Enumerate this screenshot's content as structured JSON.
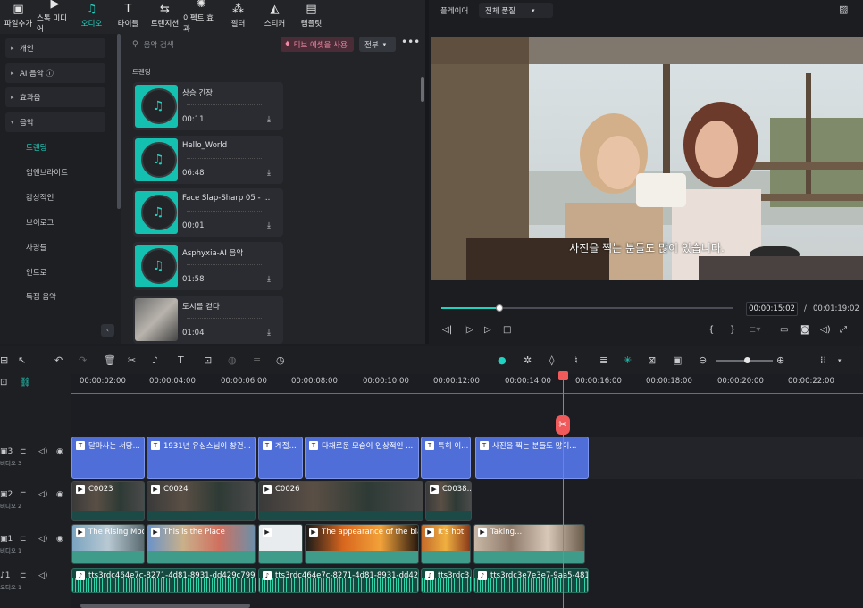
{
  "toolbar": [
    {
      "label": "파일추가",
      "icon": "import-icon"
    },
    {
      "label": "스톡 미디어",
      "icon": "stock-icon"
    },
    {
      "label": "오디오",
      "icon": "music-icon",
      "active": true
    },
    {
      "label": "타이틀",
      "icon": "title-icon"
    },
    {
      "label": "트랜지션",
      "icon": "transition-icon"
    },
    {
      "label": "이펙트 효과",
      "icon": "effects-icon"
    },
    {
      "label": "필터",
      "icon": "filter-icon"
    },
    {
      "label": "스티커",
      "icon": "sticker-icon"
    },
    {
      "label": "템플릿",
      "icon": "template-icon"
    }
  ],
  "sidebar": {
    "groups": [
      "개인",
      "AI 음악 ⓘ",
      "효과음",
      "음악"
    ],
    "subitems": [
      "트랜딩",
      "엄앤브라이트",
      "감상적인",
      "브이로그",
      "사랑들",
      "인트로",
      "독점 음악"
    ],
    "selected": "트랜딩"
  },
  "library": {
    "search_placeholder": "음악 검색",
    "promo": "티브 에셋을 사용",
    "filter": "전부",
    "section": "트랜딩",
    "tracks": [
      {
        "name": "상승 긴장",
        "duration": "00:11"
      },
      {
        "name": "Hello_World",
        "duration": "06:48"
      },
      {
        "name": "Face Slap-Sharp 05 - ...",
        "duration": "00:01"
      },
      {
        "name": "Asphyxia-AI 음악",
        "duration": "01:58"
      },
      {
        "name": "도시를 걷다",
        "duration": "01:04"
      }
    ]
  },
  "player": {
    "title": "플레이어",
    "quality": "전체 품질",
    "caption": "사진을 찍는 분들도 많이 있습니다.",
    "current_time": "00:00:15:02",
    "separator": "/",
    "total_time": "00:01:19:02",
    "progress": 0.2
  },
  "timeline": {
    "ticks": [
      "00:00:02:00",
      "00:00:04:00",
      "00:00:06:00",
      "00:00:08:00",
      "00:00:10:00",
      "00:00:12:00",
      "00:00:14:00",
      "00:00:16:00",
      "00:00:18:00",
      "00:00:20:00",
      "00:00:22:00"
    ],
    "tracks": [
      {
        "num": "3",
        "label": "비디오 3"
      },
      {
        "num": "2",
        "label": "비디오 2"
      },
      {
        "num": "1",
        "label": "비디오 1"
      },
      {
        "num": "1",
        "label": "오디오 1"
      }
    ],
    "text_clips": [
      "달마사는 서당...",
      "1931년 유심스님이 창건...",
      "계절...",
      "다채로운 모습이 인상적인 ...",
      "특히 이...",
      "사진을 찍는 분들도 많이..."
    ],
    "video2_clips": [
      "C0023",
      "C0024",
      "C0026",
      "C0038..."
    ],
    "video1_clips": [
      "The Rising Moon",
      "This is the Place",
      "",
      "The appearance of the blank",
      "It's hot",
      "Taking..."
    ],
    "audio_clips": [
      "tts3rdc464e7c-8271-4d81-8931-dd429c799b99",
      "tts3rdc464e7c-8271-4d81-8931-dd429...",
      "tts3rdc3...",
      "tts3rdc3e7e3e7-9aa5-481..."
    ]
  }
}
